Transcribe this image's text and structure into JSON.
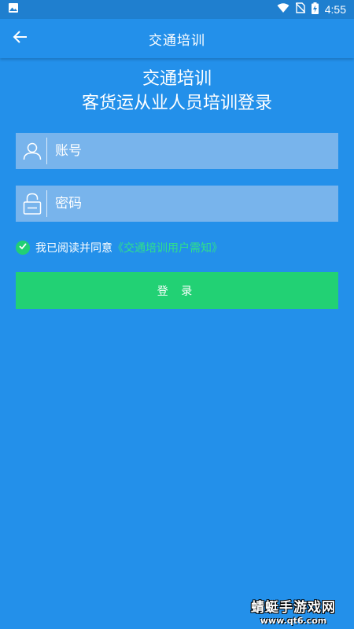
{
  "status_bar": {
    "time": "4:55",
    "icons": [
      "image-icon",
      "wifi-icon",
      "no-sim-icon",
      "battery-charging-icon"
    ]
  },
  "app_bar": {
    "title": "交通培训",
    "back_icon": "arrow-left-icon"
  },
  "heading": {
    "line1": "交通培训",
    "line2": "客货运从业人员培训登录"
  },
  "form": {
    "username": {
      "placeholder": "账号",
      "value": "",
      "icon": "user-icon"
    },
    "password": {
      "placeholder": "密码",
      "value": "",
      "icon": "lock-icon"
    },
    "agreement": {
      "checked": true,
      "text": "我已阅读并同意",
      "link": "《交通培训用户需知》"
    },
    "login_label": "登 录"
  },
  "watermark": {
    "title": "蜻蜓手游戏网",
    "url": "www.qt6.com"
  },
  "colors": {
    "background": "#2390ea",
    "status_bar": "#1f7fcf",
    "field": "#78b4ec",
    "accent_green": "#22d174",
    "link_green": "#2fe08a"
  }
}
